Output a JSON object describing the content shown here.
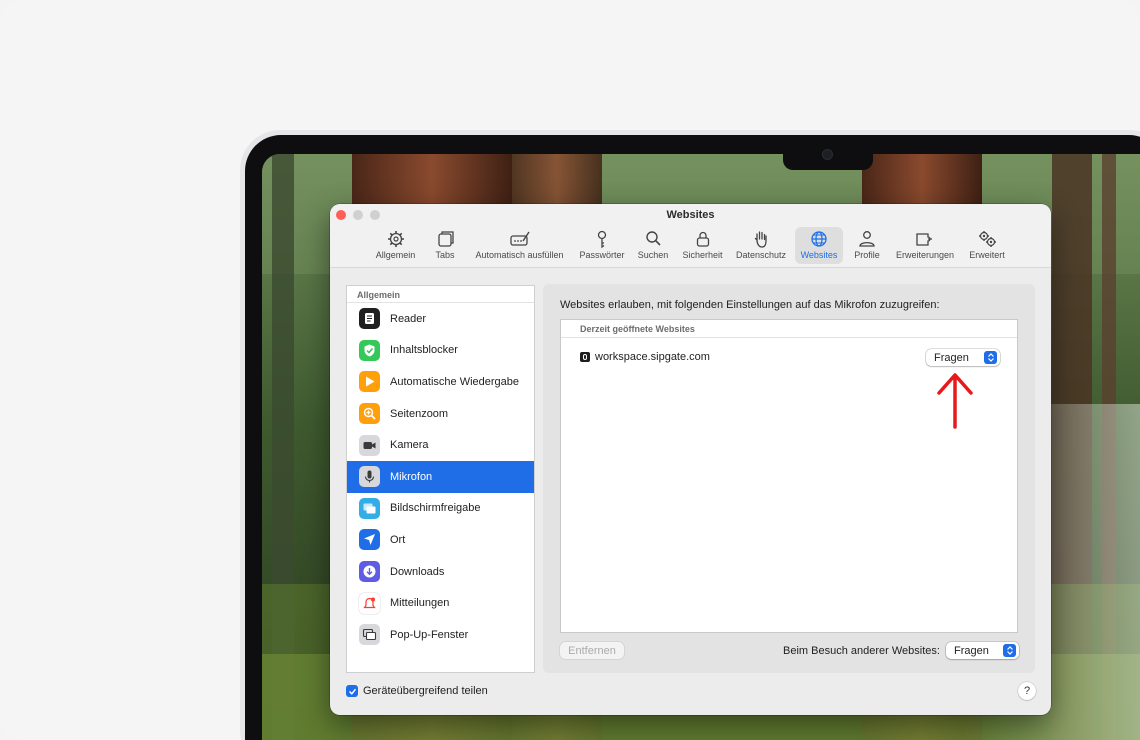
{
  "window": {
    "title": "Websites"
  },
  "toolbar": {
    "items": [
      {
        "label": "Allgemein",
        "icon": "gear-icon"
      },
      {
        "label": "Tabs",
        "icon": "tabs-icon"
      },
      {
        "label": "Automatisch ausfüllen",
        "icon": "autofill-icon"
      },
      {
        "label": "Passwörter",
        "icon": "key-icon"
      },
      {
        "label": "Suchen",
        "icon": "search-icon"
      },
      {
        "label": "Sicherheit",
        "icon": "lock-icon"
      },
      {
        "label": "Datenschutz",
        "icon": "hand-icon"
      },
      {
        "label": "Websites",
        "icon": "globe-icon",
        "active": true
      },
      {
        "label": "Profile",
        "icon": "person-icon"
      },
      {
        "label": "Erweiterungen",
        "icon": "puzzle-icon"
      },
      {
        "label": "Erweitert",
        "icon": "gears-icon"
      }
    ]
  },
  "sidebar": {
    "header": "Allgemein",
    "items": [
      {
        "label": "Reader",
        "icon": "reader-icon",
        "color": "#1f1f1f"
      },
      {
        "label": "Inhaltsblocker",
        "icon": "shield-check-icon",
        "color": "#34c759"
      },
      {
        "label": "Automatische Wiedergabe",
        "icon": "play-icon",
        "color": "#ff9f0a"
      },
      {
        "label": "Seitenzoom",
        "icon": "zoom-icon",
        "color": "#ff9f0a"
      },
      {
        "label": "Kamera",
        "icon": "camera-icon",
        "color": "#8e8e93"
      },
      {
        "label": "Mikrofon",
        "icon": "microphone-icon",
        "color": "#8e8e93",
        "selected": true
      },
      {
        "label": "Bildschirmfreigabe",
        "icon": "screen-share-icon",
        "color": "#32ade6"
      },
      {
        "label": "Ort",
        "icon": "location-icon",
        "color": "#1f6ee8"
      },
      {
        "label": "Downloads",
        "icon": "download-icon",
        "color": "#5e5ce6"
      },
      {
        "label": "Mitteilungen",
        "icon": "bell-icon",
        "color": "#ff3b30"
      },
      {
        "label": "Pop-Up-Fenster",
        "icon": "popup-window-icon",
        "color": "#8e8e93"
      }
    ]
  },
  "panel": {
    "description": "Websites erlauben, mit folgenden Einstellungen auf das Mikrofon zuzugreifen:",
    "table_header": "Derzeit geöffnete Websites",
    "rows": [
      {
        "site": "workspace.sipgate.com",
        "setting": "Fragen"
      }
    ],
    "remove_button": "Entfernen",
    "other_sites_label": "Beim Besuch anderer Websites:",
    "other_sites_value": "Fragen"
  },
  "footer": {
    "share_label": "Geräteübergreifend teilen",
    "share_checked": true,
    "help_label": "?"
  },
  "annotation": {
    "arrow_color": "#e8191a"
  }
}
